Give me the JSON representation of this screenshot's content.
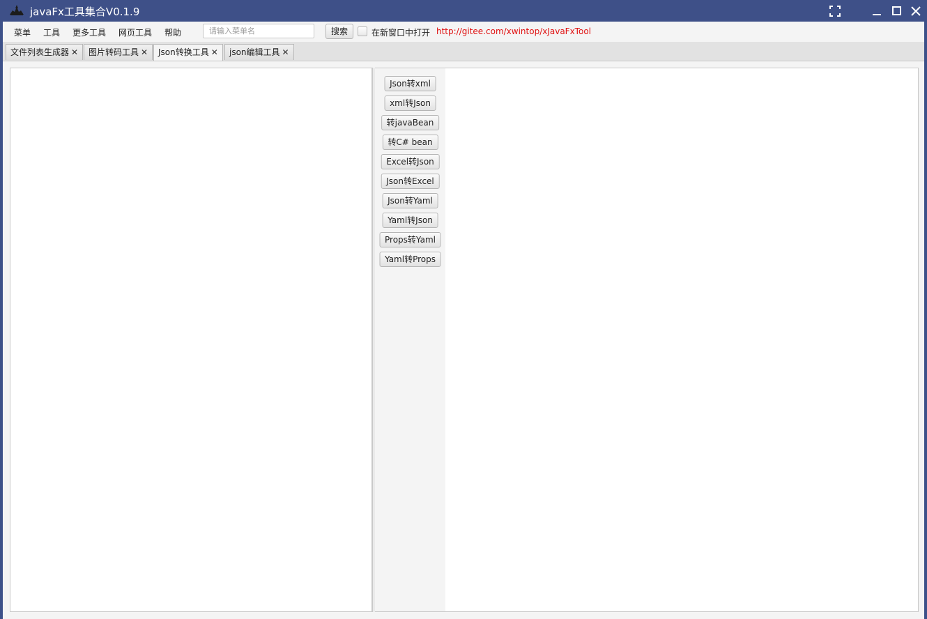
{
  "window": {
    "title": "javaFx工具集合V0.1.9"
  },
  "menubar": {
    "items": [
      "菜单",
      "工具",
      "更多工具",
      "网页工具",
      "帮助"
    ],
    "search_placeholder": "请输入菜单名",
    "search_value": "",
    "search_button": "搜索",
    "open_new_window_label": "在新窗口中打开",
    "open_new_window_checked": false,
    "repo_link": "http://gitee.com/xwintop/xJavaFxTool"
  },
  "tabs": [
    {
      "label": "文件列表生成器",
      "active": false
    },
    {
      "label": "图片转码工具",
      "active": false
    },
    {
      "label": "Json转换工具",
      "active": true
    },
    {
      "label": "json编辑工具",
      "active": false
    }
  ],
  "converter_buttons": [
    "Json转xml",
    "xml转Json",
    "转javaBean",
    "转C# bean",
    "Excel转Json",
    "Json转Excel",
    "Json转Yaml",
    "Yaml转Json",
    "Props转Yaml",
    "Yaml转Props"
  ],
  "colors": {
    "titlebar": "#3e5088",
    "link": "#e01010"
  },
  "icons": {
    "app": "app-logo-icon",
    "fullscreen": "fullscreen-icon",
    "minimize": "minimize-icon",
    "maximize": "maximize-icon",
    "close": "close-icon",
    "tab_close": "×"
  }
}
